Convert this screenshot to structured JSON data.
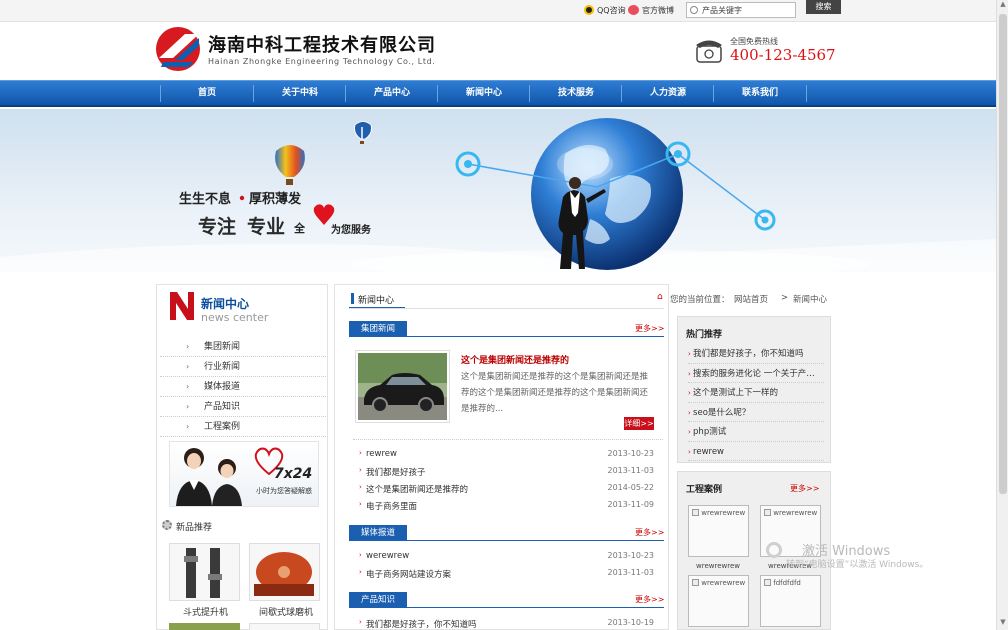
{
  "topbar": {
    "qq": "QQ咨询",
    "weibo": "官方微博",
    "search_placeholder": "产品关键字",
    "search_button": "搜索"
  },
  "header": {
    "company_cn": "海南中科工程技术有限公司",
    "company_en": "Hainan Zhongke Engineering Technology Co., Ltd.",
    "hotline_label": "全国免费热线",
    "hotline_number": "400-123-4567"
  },
  "nav": [
    "首页",
    "关于中科",
    "产品中心",
    "新闻中心",
    "技术服务",
    "人力资源",
    "联系我们"
  ],
  "banner": {
    "slogan1a": "生生不息",
    "slogan1b": "厚积薄发",
    "slogan2a": "专注",
    "slogan2b": "专业",
    "slogan2c": "全",
    "slogan2d": "为您服务"
  },
  "left": {
    "title_cn": "新闻中心",
    "title_en": "news center",
    "menu": [
      "集团新闻",
      "行业新闻",
      "媒体报道",
      "产品知识",
      "工程案例"
    ],
    "service_num": "7x24",
    "service_text": "小时为您答疑解惑",
    "new_products_title": "新品推荐",
    "products": [
      "斗式提升机",
      "间歇式球磨机"
    ]
  },
  "main": {
    "tab": "新闻中心",
    "breadcrumb_label": "您的当前位置：",
    "breadcrumb_home": "网站首页",
    "breadcrumb_sep": ">",
    "breadcrumb_current": "新闻中心",
    "more": "更多>>",
    "sections": [
      {
        "title": "集团新闻",
        "featured": {
          "title": "这个是集团新闻还是推荐的",
          "summary": "这个是集团新闻还是推荐的这个是集团新闻还是推荐的这个是集团新闻还是推荐的这个是集团新闻还是推荐的...",
          "detail": "详细>>"
        },
        "items": [
          {
            "text": "rewrew",
            "date": "2013-10-23"
          },
          {
            "text": "我们都是好孩子",
            "date": "2013-11-03"
          },
          {
            "text": "这个是集团新闻还是推荐的",
            "date": "2014-05-22"
          },
          {
            "text": "电子商务里面",
            "date": "2013-11-09"
          }
        ]
      },
      {
        "title": "媒体报道",
        "items": [
          {
            "text": "werewrew",
            "date": "2013-10-23"
          },
          {
            "text": "电子商务网站建设方案",
            "date": "2013-11-03"
          }
        ]
      },
      {
        "title": "产品知识",
        "items": [
          {
            "text": "我们都是好孩子，你不知道吗",
            "date": "2013-10-19"
          }
        ]
      }
    ]
  },
  "right": {
    "hot_title": "热门推荐",
    "hot_items": [
      "我们都是好孩子，你不知道吗",
      "搜索的服务进化论 一个关于产…",
      "这个是测试上下一样的",
      "seo是什么呢？",
      "php测试",
      "rewrew"
    ],
    "cases_title": "工程案例",
    "cases_more": "更多>>",
    "cases": [
      {
        "img_alt": "wrewrewrew",
        "caption": "wrewrewrew"
      },
      {
        "img_alt": "wrewrewrew",
        "caption": "wrewrewrew"
      },
      {
        "img_alt": "wrewrewrew",
        "caption": ""
      },
      {
        "img_alt": "fdfdfdfd",
        "caption": ""
      }
    ]
  },
  "watermark": {
    "line1": "激活 Windows",
    "line2": "转到“电脑设置”以激活 Windows。"
  },
  "colors": {
    "nav_blue": "#1b5fb0",
    "accent_red": "#c00000"
  }
}
